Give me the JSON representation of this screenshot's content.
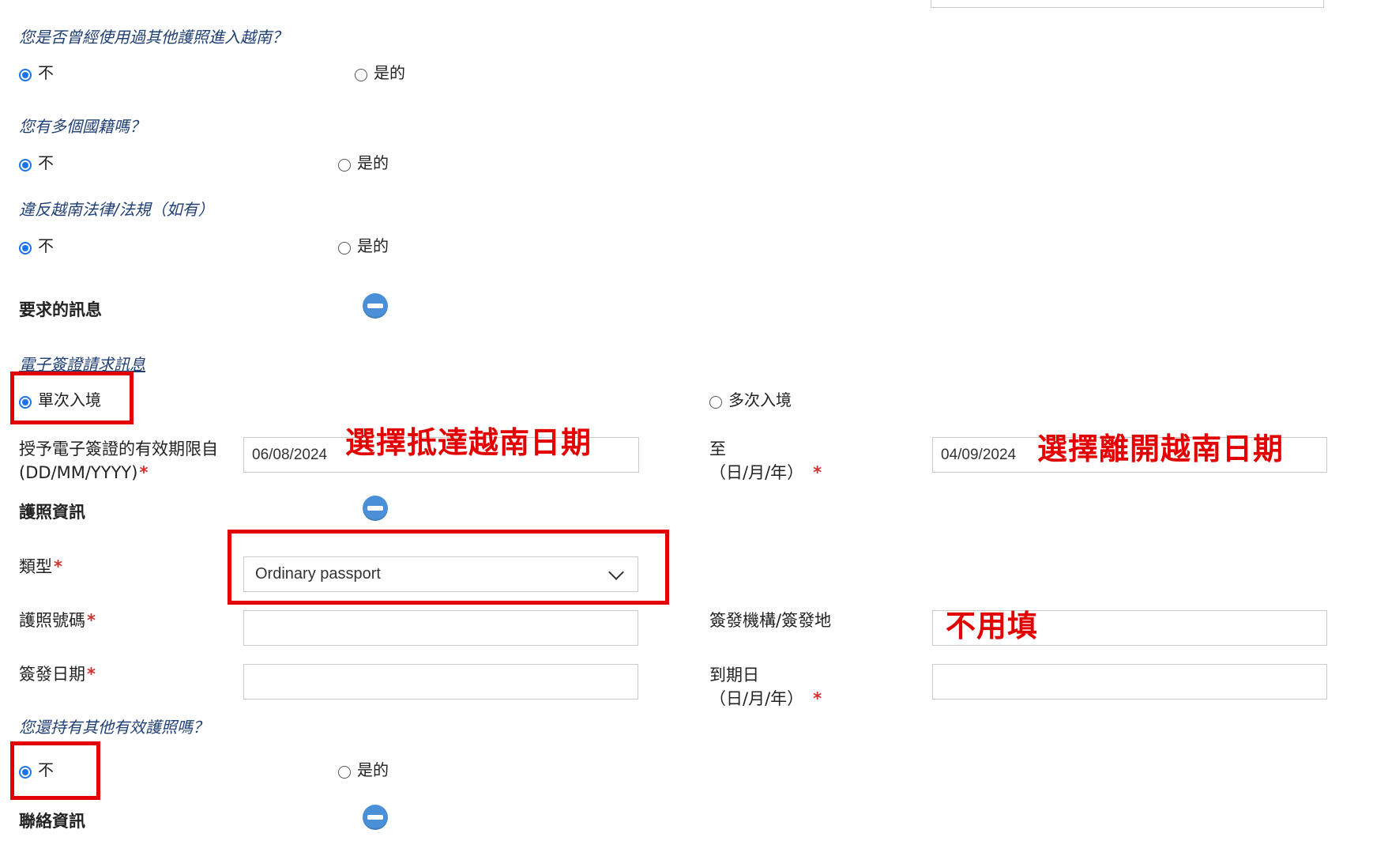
{
  "questions": {
    "q1": {
      "text": "您是否曾經使用過其他護照進入越南？",
      "no": "不",
      "yes": "是的"
    },
    "q2": {
      "text": "您有多個國籍嗎？",
      "no": "不",
      "yes": "是的"
    },
    "q3": {
      "text": "違反越南法律/法規（如有）",
      "no": "不",
      "yes": "是的"
    },
    "q4": {
      "text": "您還持有其他有效護照嗎？",
      "no": "不",
      "yes": "是的"
    }
  },
  "sections": {
    "requested_info": "要求的訊息",
    "passport_info": "護照資訊",
    "contact_info": "聯絡資訊"
  },
  "evisa": {
    "title": "電子簽證請求訊息",
    "single_entry": "單次入境",
    "multiple_entry": "多次入境",
    "validity_label_line1": "授予電子簽證的有效期限自",
    "validity_label_line2": "(DD/MM/YYYY)",
    "to_label_line1": "至",
    "to_label_line2": "（日/月/年）",
    "from_date": "06/08/2024",
    "to_date": "04/09/2024"
  },
  "passport": {
    "type_label": "類型",
    "type_value": "Ordinary passport",
    "number_label": "護照號碼",
    "number_value": "",
    "authority_label": "簽發機構/簽發地",
    "authority_value": "",
    "issue_date_label": "簽發日期",
    "issue_date_value": "",
    "expiry_label_line1": "到期日",
    "expiry_label_line2": "（日/月/年）",
    "expiry_value": ""
  },
  "required_mark": "*",
  "annotations": {
    "arrival": "選擇抵達越南日期",
    "departure": "選擇離開越南日期",
    "no_need": "不用填"
  },
  "colors": {
    "accent": "#1a73e8",
    "annotation_red": "#e20000",
    "question_text": "#1f3f73",
    "collapse_button": "#4a90d9"
  }
}
